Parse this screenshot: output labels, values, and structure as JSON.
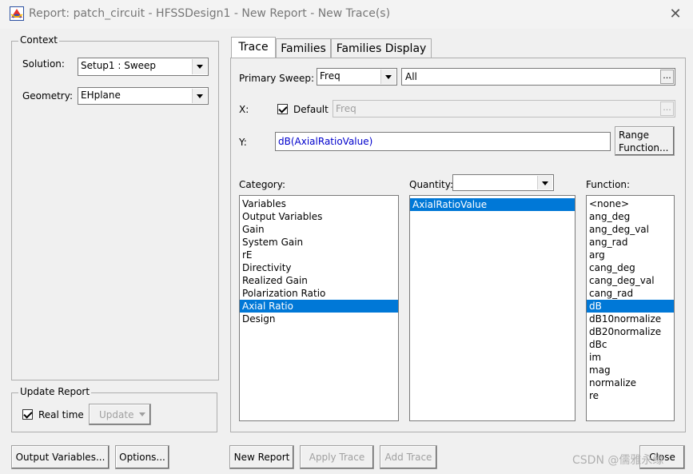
{
  "window": {
    "title": "Report: patch_circuit - HFSSDesign1 - New Report - New Trace(s)",
    "close_glyph": "✕"
  },
  "context": {
    "legend": "Context",
    "solution_label": "Solution:",
    "solution_value": "Setup1 : Sweep",
    "geometry_label": "Geometry:",
    "geometry_value": "EHplane"
  },
  "update_report": {
    "legend": "Update Report",
    "realtime_label": "Real time",
    "realtime_checked": true,
    "update_button": "Update"
  },
  "tabs": [
    {
      "label": "Trace",
      "active": true
    },
    {
      "label": "Families",
      "active": false
    },
    {
      "label": "Families Display",
      "active": false
    }
  ],
  "trace": {
    "primary_sweep_label": "Primary Sweep:",
    "primary_sweep_value": "Freq",
    "primary_sweep_range": "All",
    "ellipsis": "...",
    "x_label": "X:",
    "default_label": "Default",
    "default_checked": true,
    "x_value": "Freq",
    "y_label": "Y:",
    "y_value": "dB(AxialRatioValue)",
    "range_function_line1": "Range",
    "range_function_line2": "Function...",
    "category_label": "Category:",
    "quantity_label": "Quantity:",
    "function_label": "Function:",
    "categories": [
      "Variables",
      "Output Variables",
      "Gain",
      "System Gain",
      "rE",
      "Directivity",
      "Realized Gain",
      "Polarization Ratio",
      "Axial Ratio",
      "Design"
    ],
    "category_selected": "Axial Ratio",
    "quantities": [
      "AxialRatioValue"
    ],
    "quantity_selected": "AxialRatioValue",
    "functions": [
      "<none>",
      "ang_deg",
      "ang_deg_val",
      "ang_rad",
      "arg",
      "cang_deg",
      "cang_deg_val",
      "cang_rad",
      "dB",
      "dB10normalize",
      "dB20normalize",
      "dBc",
      "im",
      "mag",
      "normalize",
      "re"
    ],
    "function_selected": "dB"
  },
  "buttons": {
    "output_variables": "Output Variables...",
    "options": "Options...",
    "new_report": "New Report",
    "apply_trace": "Apply Trace",
    "add_trace": "Add Trace",
    "close": "Close"
  },
  "watermark": "CSDN @儒雅永缘",
  "colors": {
    "selection": "#0078d7",
    "y_text": "#0000cc"
  }
}
